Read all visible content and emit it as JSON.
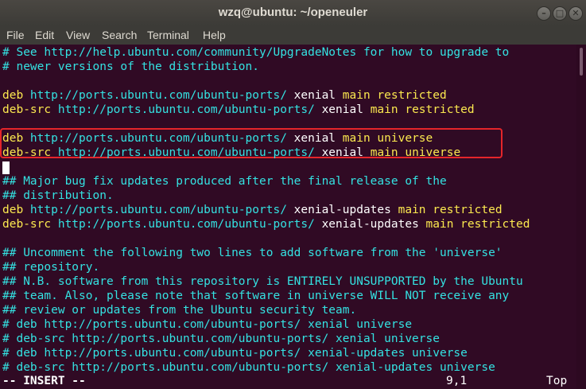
{
  "window": {
    "title": "wzq@ubuntu: ~/openeuler"
  },
  "menu": [
    "File",
    "Edit",
    "View",
    "Search",
    "Terminal",
    "Help"
  ],
  "lines": [
    [
      {
        "t": "# See http://help.ubuntu.com/community/UpgradeNotes for how to upgrade to",
        "c": "c"
      }
    ],
    [
      {
        "t": "# newer versions of the distribution.",
        "c": "c"
      }
    ],
    [],
    [
      {
        "t": "deb ",
        "c": "y"
      },
      {
        "t": "http://ports.ubuntu.com/ubuntu-ports/ ",
        "c": "c"
      },
      {
        "t": "xenial ",
        "c": "w"
      },
      {
        "t": "main restricted",
        "c": "y"
      }
    ],
    [
      {
        "t": "deb-src ",
        "c": "y"
      },
      {
        "t": "http://ports.ubuntu.com/ubuntu-ports/ ",
        "c": "c"
      },
      {
        "t": "xenial ",
        "c": "w"
      },
      {
        "t": "main restricted",
        "c": "y"
      }
    ],
    [],
    [
      {
        "t": "deb ",
        "c": "y"
      },
      {
        "t": "http://ports.ubuntu.com/ubuntu-ports/ ",
        "c": "c"
      },
      {
        "t": "xenial ",
        "c": "w"
      },
      {
        "t": "main universe",
        "c": "y"
      }
    ],
    [
      {
        "t": "deb-src ",
        "c": "y"
      },
      {
        "t": "http://ports.ubuntu.com/ubuntu-ports/ ",
        "c": "c"
      },
      {
        "t": "xenial ",
        "c": "w"
      },
      {
        "t": "main universe",
        "c": "y"
      }
    ],
    [],
    [
      {
        "t": "## Major bug fix updates produced after the final release of the",
        "c": "c"
      }
    ],
    [
      {
        "t": "## distribution.",
        "c": "c"
      }
    ],
    [
      {
        "t": "deb ",
        "c": "y"
      },
      {
        "t": "http://ports.ubuntu.com/ubuntu-ports/ ",
        "c": "c"
      },
      {
        "t": "xenial-updates ",
        "c": "w"
      },
      {
        "t": "main restricted",
        "c": "y"
      }
    ],
    [
      {
        "t": "deb-src ",
        "c": "y"
      },
      {
        "t": "http://ports.ubuntu.com/ubuntu-ports/ ",
        "c": "c"
      },
      {
        "t": "xenial-updates ",
        "c": "w"
      },
      {
        "t": "main restricted",
        "c": "y"
      }
    ],
    [],
    [
      {
        "t": "## Uncomment the following two lines to add software from the 'universe'",
        "c": "c"
      }
    ],
    [
      {
        "t": "## repository.",
        "c": "c"
      }
    ],
    [
      {
        "t": "## N.B. software from this repository is ENTIRELY UNSUPPORTED by the Ubuntu",
        "c": "c"
      }
    ],
    [
      {
        "t": "## team. Also, please note that software in universe WILL NOT receive any",
        "c": "c"
      }
    ],
    [
      {
        "t": "## review or updates from the Ubuntu security team.",
        "c": "c"
      }
    ],
    [
      {
        "t": "# deb http://ports.ubuntu.com/ubuntu-ports/ xenial universe",
        "c": "c"
      }
    ],
    [
      {
        "t": "# deb-src http://ports.ubuntu.com/ubuntu-ports/ xenial universe",
        "c": "c"
      }
    ],
    [
      {
        "t": "# deb http://ports.ubuntu.com/ubuntu-ports/ xenial-updates universe",
        "c": "c"
      }
    ],
    [
      {
        "t": "# deb-src http://ports.ubuntu.com/ubuntu-ports/ xenial-updates universe",
        "c": "c"
      }
    ]
  ],
  "status": {
    "mode": "-- INSERT --",
    "position": "9,1",
    "scroll": "Top"
  },
  "colors": {
    "background": "#300a24",
    "cyan": "#34e2e2",
    "yellow": "#fce94f",
    "highlight": "#e5252a"
  }
}
